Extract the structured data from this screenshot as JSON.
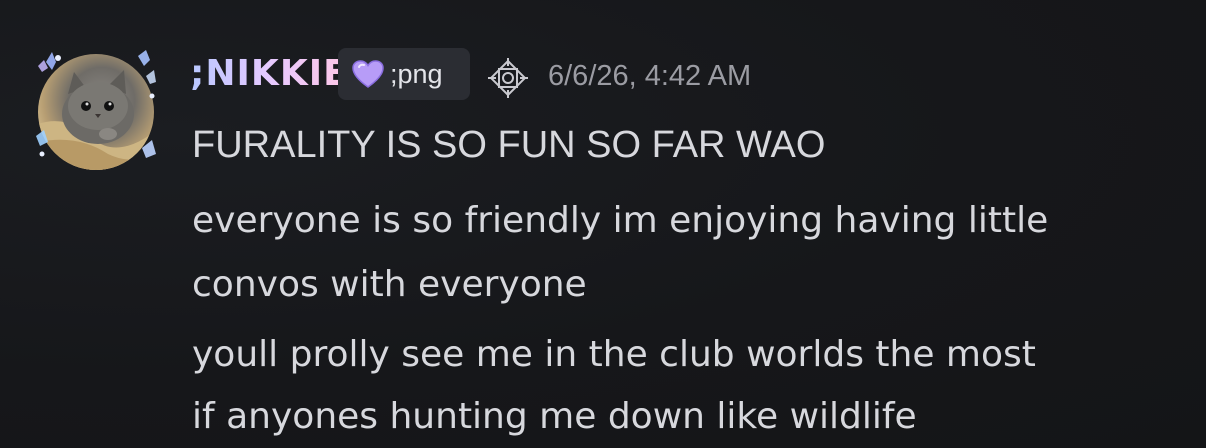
{
  "message": {
    "author": {
      "display_name": ";NIKKIE",
      "tag_text": ";png",
      "tag_icon": "purple-heart-icon",
      "role_icon": "ornament-diamond-icon",
      "avatar": "gray-kitten-avatar"
    },
    "timestamp": "6/6/26, 4:42 AM",
    "lines": [
      "FURALITY IS SO FUN SO FAR WAO",
      "everyone is so friendly im enjoying having little",
      "convos with everyone",
      "youll prolly see me in the club worlds the most",
      "if anyones hunting me down like wildlife"
    ]
  },
  "colors": {
    "background": "#16171a",
    "text": "#d7d8dd",
    "timestamp": "#9b9ca3",
    "tag_badge": "#2b2d33",
    "name_gradient_start": "#b8c8ff",
    "name_gradient_end": "#ffc7e6"
  }
}
